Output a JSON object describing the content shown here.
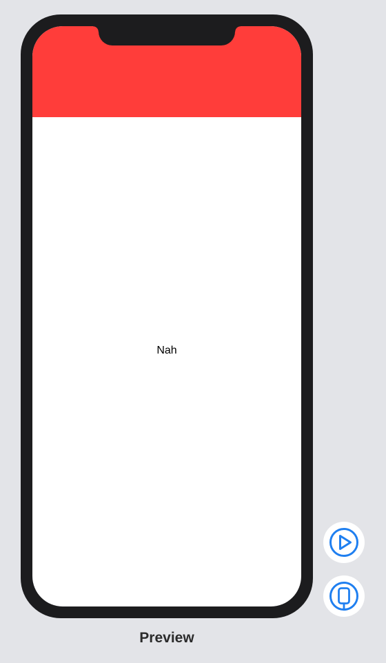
{
  "preview": {
    "caption": "Preview",
    "header_color": "#ff3d3a",
    "content_text": "Nah"
  },
  "controls": {
    "live_icon": "play-circle-icon",
    "device_icon": "device-settings-icon",
    "accent_color": "#1f7ff0"
  }
}
